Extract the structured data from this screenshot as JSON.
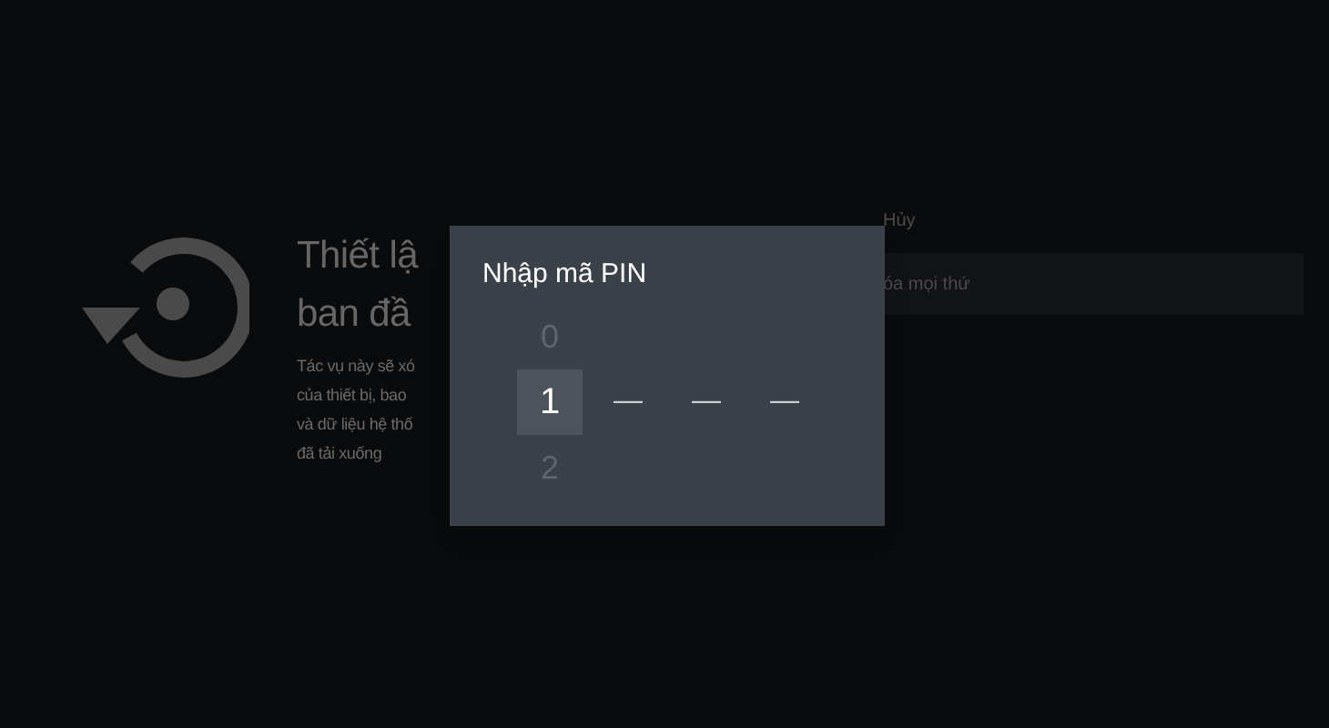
{
  "background": {
    "title_lines": [
      "Thiết lậ",
      "ban đầ"
    ],
    "description_lines": [
      "Tác vụ này sẽ xó",
      "của thiết bị, bao",
      "và dữ liệu hệ thố",
      "đã tải xuống"
    ],
    "actions": [
      {
        "label": "Hủy",
        "selected": false
      },
      {
        "label": "óa mọi thứ",
        "selected": true
      }
    ]
  },
  "dialog": {
    "title": "Nhập mã PIN",
    "slots": [
      {
        "above": "0",
        "value": "1",
        "below": "2",
        "selected": true
      },
      {
        "value": "—",
        "selected": false
      },
      {
        "value": "—",
        "selected": false
      },
      {
        "value": "—",
        "selected": false
      }
    ]
  }
}
